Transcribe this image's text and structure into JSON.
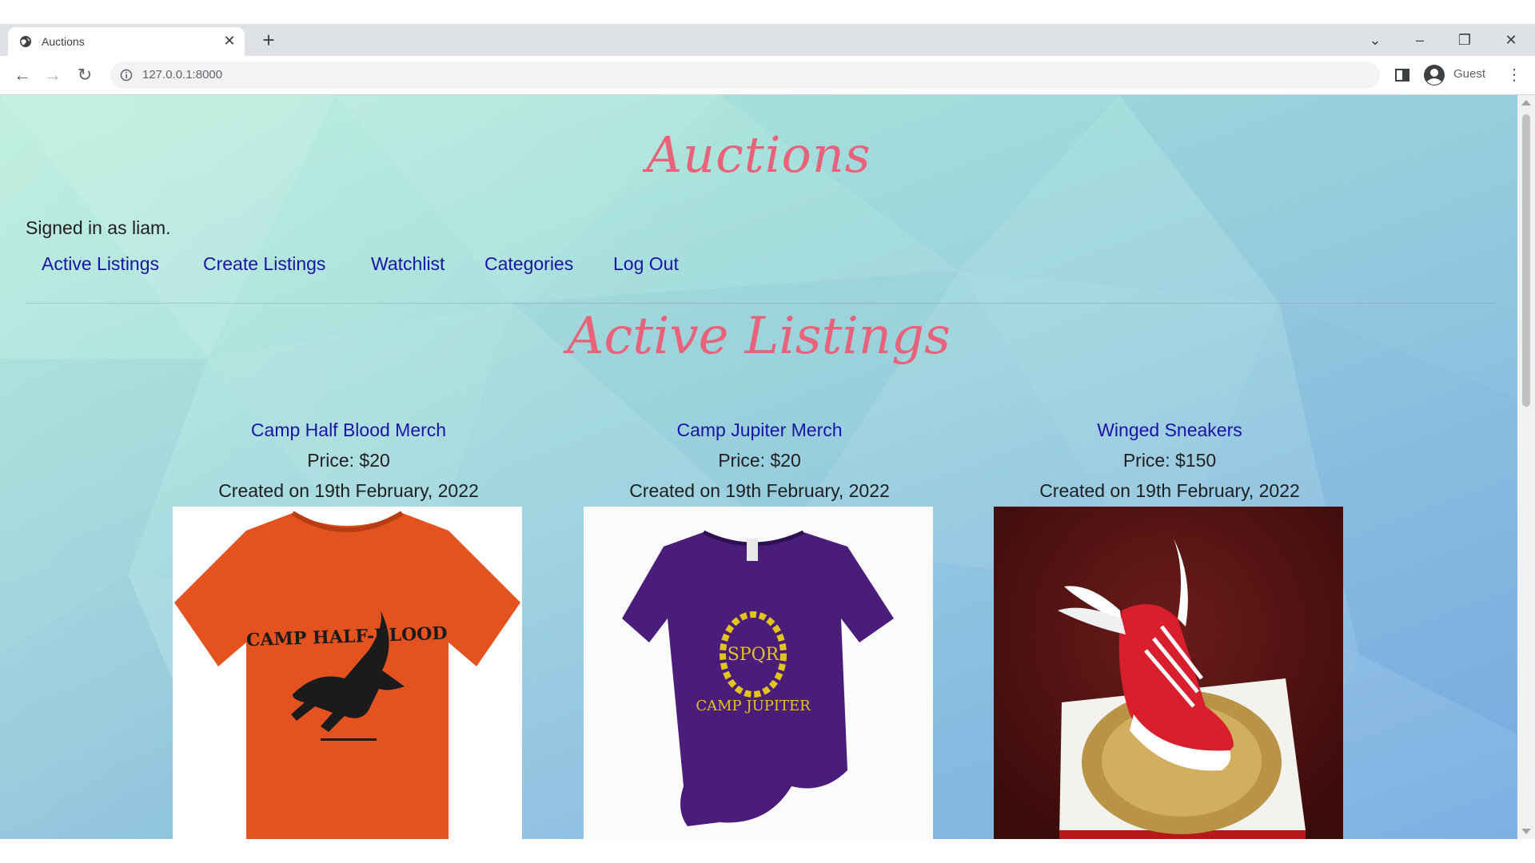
{
  "browser": {
    "tab_title": "Auctions",
    "url": "127.0.0.1:8000",
    "profile_label": "Guest"
  },
  "site": {
    "title": "Auctions",
    "signed_in_prefix": "Signed in as ",
    "username": "liam.",
    "nav": [
      "Active Listings",
      "Create Listings",
      "Watchlist",
      "Categories",
      "Log Out"
    ]
  },
  "main": {
    "heading": "Active Listings",
    "listings": [
      {
        "name": "Camp Half Blood Merch",
        "price": "Price: $20",
        "created": "Created on 19th February, 2022",
        "image_label": "CAMP HALF-BLOOD"
      },
      {
        "name": "Camp Jupiter Merch",
        "price": "Price: $20",
        "created": "Created on 19th February, 2022",
        "image_label_top": "SPQR",
        "image_label_bottom": "CAMP JUPITER"
      },
      {
        "name": "Winged Sneakers",
        "price": "Price: $150",
        "created": "Created on 19th February, 2022"
      }
    ]
  },
  "colors": {
    "heading": "#e8627a",
    "link": "#1a13a8",
    "shirt_orange": "#e4531f",
    "shirt_purple": "#4b1d7a",
    "laurel_gold": "#e3c41b",
    "sneaker_red": "#d91f2e",
    "cake_background": "#4a0f10"
  },
  "icons": [
    "globe-icon",
    "close-icon",
    "plus-icon",
    "chevron-down-icon",
    "minimize-icon",
    "restore-icon",
    "back-arrow-icon",
    "forward-arrow-icon",
    "reload-icon",
    "info-icon",
    "sidebar-icon",
    "profile-icon",
    "kebab-menu-icon"
  ]
}
